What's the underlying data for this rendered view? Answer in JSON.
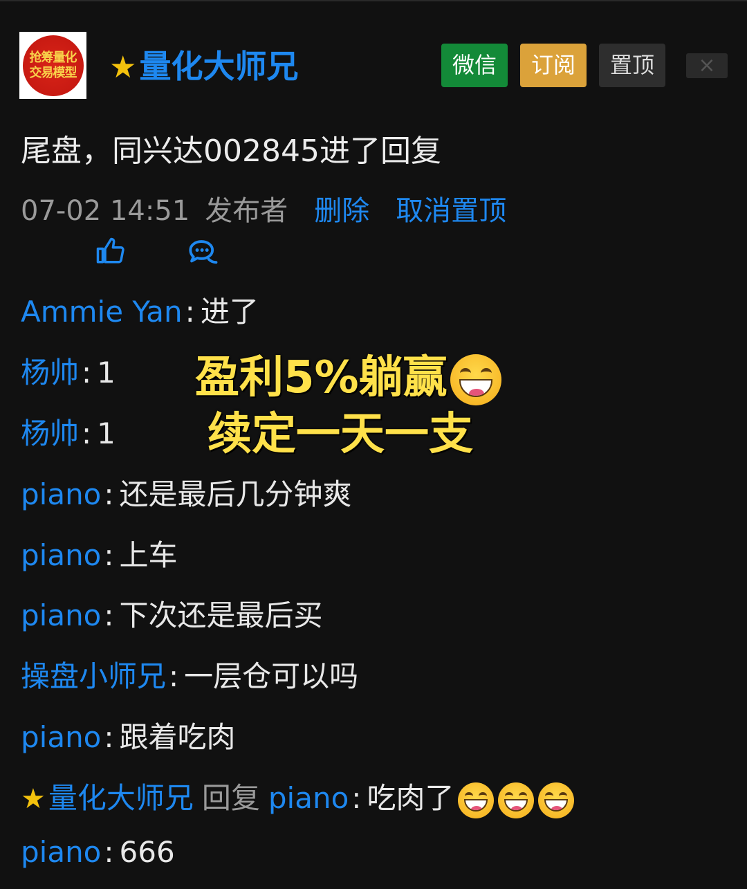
{
  "header": {
    "avatar_text": [
      "抢筹量化",
      "交易模型"
    ],
    "author_name": "量化大师兄",
    "buttons": {
      "wechat": "微信",
      "subscribe": "订阅",
      "pin": "置顶",
      "close": "×"
    }
  },
  "post": {
    "text": "尾盘，同兴达002845进了回复",
    "time": "07-02 14:51",
    "by_label": "发布者",
    "delete_label": "删除",
    "unpin_label": "取消置顶"
  },
  "overlay": {
    "line1": "盈利5%躺赢",
    "line2": "续定一天一支"
  },
  "comments": [
    {
      "user": "Ammie Yan",
      "text": "进了"
    },
    {
      "user": "杨帅",
      "text": "1"
    },
    {
      "user": "杨帅",
      "text": "1"
    },
    {
      "user": "piano",
      "text": "还是最后几分钟爽"
    },
    {
      "user": "piano",
      "text": "上车"
    },
    {
      "user": "piano",
      "text": "下次还是最后买"
    },
    {
      "user": "操盘小师兄",
      "text": "一层仓可以吗"
    },
    {
      "user": "piano",
      "text": "跟着吃肉"
    },
    {
      "user": "量化大师兄",
      "reply_word": "回复",
      "reply_to": "piano",
      "text": "吃肉了"
    },
    {
      "user": "piano",
      "text": "666"
    }
  ],
  "colors": {
    "background": "#111111",
    "link": "#1e88f0",
    "wechat": "#138a38",
    "subscribe": "#dba23a",
    "overlay": "#ffe14a"
  },
  "icons": {
    "star": "star-icon",
    "like": "thumbs-up-icon",
    "comment": "comment-bubble-icon",
    "emoji": "grinning-face-emoji"
  }
}
